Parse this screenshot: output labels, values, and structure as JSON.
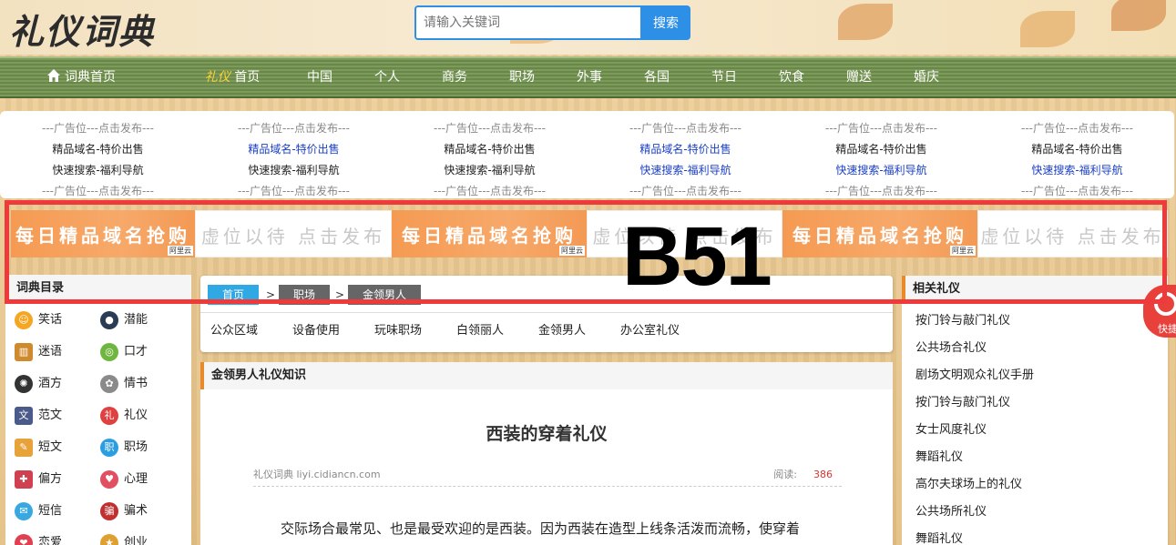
{
  "header": {
    "logo": "礼仪词典",
    "search_placeholder": "请输入关键词",
    "search_button": "搜索"
  },
  "nav": {
    "home": "词典首页",
    "liyi_highlight": "礼仪",
    "liyi_home": "首页",
    "items": [
      "中国",
      "个人",
      "商务",
      "职场",
      "外事",
      "各国",
      "节日",
      "饮食",
      "赠送",
      "婚庆"
    ]
  },
  "ads": {
    "dash": "---广告位---点击发布---",
    "line1": "精品域名-特价出售",
    "line2": "快速搜索-福利导航"
  },
  "banners": {
    "orange_text": "每日精品域名抢购",
    "white_text": "虚位以待 点击发布",
    "tag": "阿里云"
  },
  "overlay_label": "B51",
  "sidebar": {
    "title": "词典目录",
    "items": [
      {
        "label": "笑话",
        "color": "#f5a623"
      },
      {
        "label": "潜能",
        "color": "#2a3b55"
      },
      {
        "label": "迷语",
        "color": "#d08a2e"
      },
      {
        "label": "口才",
        "color": "#6fb640"
      },
      {
        "label": "酒方",
        "color": "#333333"
      },
      {
        "label": "情书",
        "color": "#8a8a8a"
      },
      {
        "label": "范文",
        "color": "#4a5a8a"
      },
      {
        "label": "礼仪",
        "color": "#e04040"
      },
      {
        "label": "短文",
        "color": "#e8a23a"
      },
      {
        "label": "职场",
        "color": "#2a9ee0"
      },
      {
        "label": "偏方",
        "color": "#d04050"
      },
      {
        "label": "心理",
        "color": "#e05060"
      },
      {
        "label": "短信",
        "color": "#3aa8e0"
      },
      {
        "label": "骗术",
        "color": "#c03030"
      },
      {
        "label": "恋爱",
        "color": "#e04050"
      },
      {
        "label": "创业",
        "color": "#e0a030"
      }
    ]
  },
  "breadcrumb": {
    "home": "首页",
    "level2": "职场",
    "level3": "金领男人",
    "sep": ">"
  },
  "sub_nav": [
    "公众区域",
    "设备使用",
    "玩味职场",
    "白领丽人",
    "金领男人",
    "办公室礼仪"
  ],
  "article": {
    "section_title": "金领男人礼仪知识",
    "title": "西装的穿着礼仪",
    "source": "礼仪词典 liyi.cidiancn.com",
    "read_label": "阅读:",
    "read_count": "386",
    "para": "交际场合最常见、也是最受欢迎的是西装。因为西装在造型上线条活泼而流畅，使穿着"
  },
  "related": {
    "title": "相关礼仪",
    "items": [
      "按门铃与敲门礼仪",
      "公共场合礼仪",
      "剧场文明观众礼仪手册",
      "按门铃与敲门礼仪",
      "女士风度礼仪",
      "舞蹈礼仪",
      "高尔夫球场上的礼仪",
      "公共场所礼仪",
      "舞蹈礼仪"
    ]
  },
  "float": {
    "label": "快捷"
  }
}
